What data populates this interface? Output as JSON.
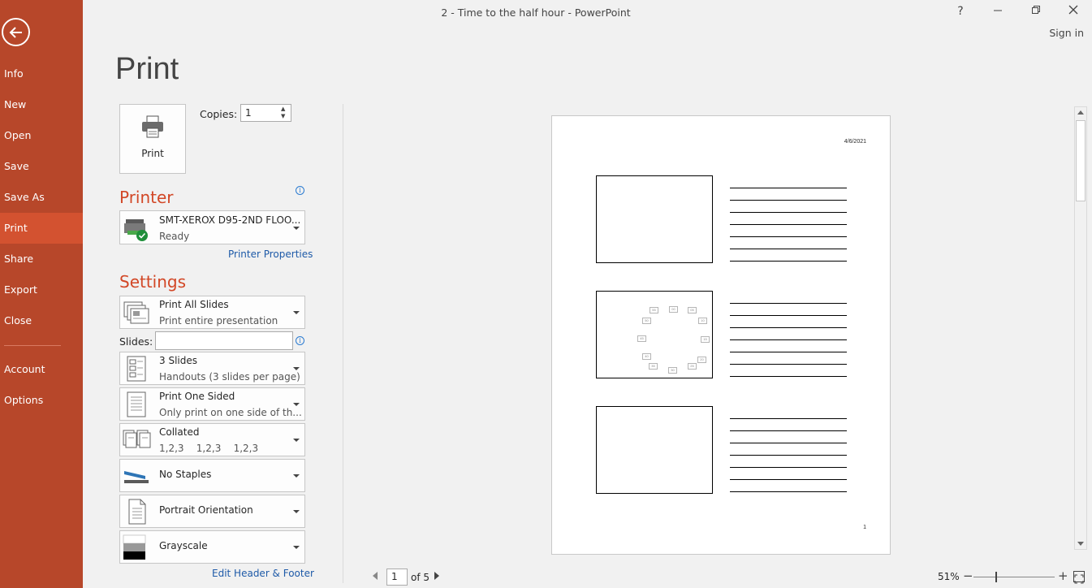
{
  "window": {
    "title": "2 - Time to the half hour - PowerPoint",
    "help": "?",
    "sign_in": "Sign in"
  },
  "nav": {
    "items": [
      {
        "label": "Info"
      },
      {
        "label": "New"
      },
      {
        "label": "Open"
      },
      {
        "label": "Save"
      },
      {
        "label": "Save As"
      },
      {
        "label": "Print",
        "active": true
      },
      {
        "label": "Share"
      },
      {
        "label": "Export"
      },
      {
        "label": "Close"
      },
      {
        "label": "Account"
      },
      {
        "label": "Options"
      }
    ]
  },
  "colors": {
    "nav_bg": "#b7472a",
    "nav_active": "#d35230",
    "accent": "#d24726",
    "link": "#1e5aa8"
  },
  "print": {
    "heading": "Print",
    "button_label": "Print",
    "copies_label": "Copies:",
    "copies_value": "1"
  },
  "printer": {
    "heading": "Printer",
    "name": "SMT-XEROX D95-2ND FLOO...",
    "status": "Ready",
    "properties_link": "Printer Properties"
  },
  "settings": {
    "heading": "Settings",
    "slides_label": "Slides:",
    "slides_value": "",
    "print_what": {
      "title": "Print All Slides",
      "subtitle": "Print entire presentation"
    },
    "layout": {
      "title": "3 Slides",
      "subtitle": "Handouts (3 slides per page)"
    },
    "sides": {
      "title": "Print One Sided",
      "subtitle": "Only print on one side of th..."
    },
    "collation": {
      "title": "Collated",
      "subtitle": "1,2,3    1,2,3    1,2,3"
    },
    "staples": {
      "title": "No Staples"
    },
    "orientation": {
      "title": "Portrait Orientation"
    },
    "color": {
      "title": "Grayscale"
    },
    "header_footer_link": "Edit Header & Footer"
  },
  "preview": {
    "date": "4/6/2021",
    "page_number": "1",
    "clock_labels": [
      "00",
      "05",
      "10",
      "15",
      "20",
      "25",
      "30",
      "35",
      "40",
      "45",
      "50",
      "55"
    ]
  },
  "pager": {
    "current_page": "1",
    "of_label": "of 5"
  },
  "zoom": {
    "percent_label": "51%",
    "minus": "−",
    "plus": "+"
  }
}
